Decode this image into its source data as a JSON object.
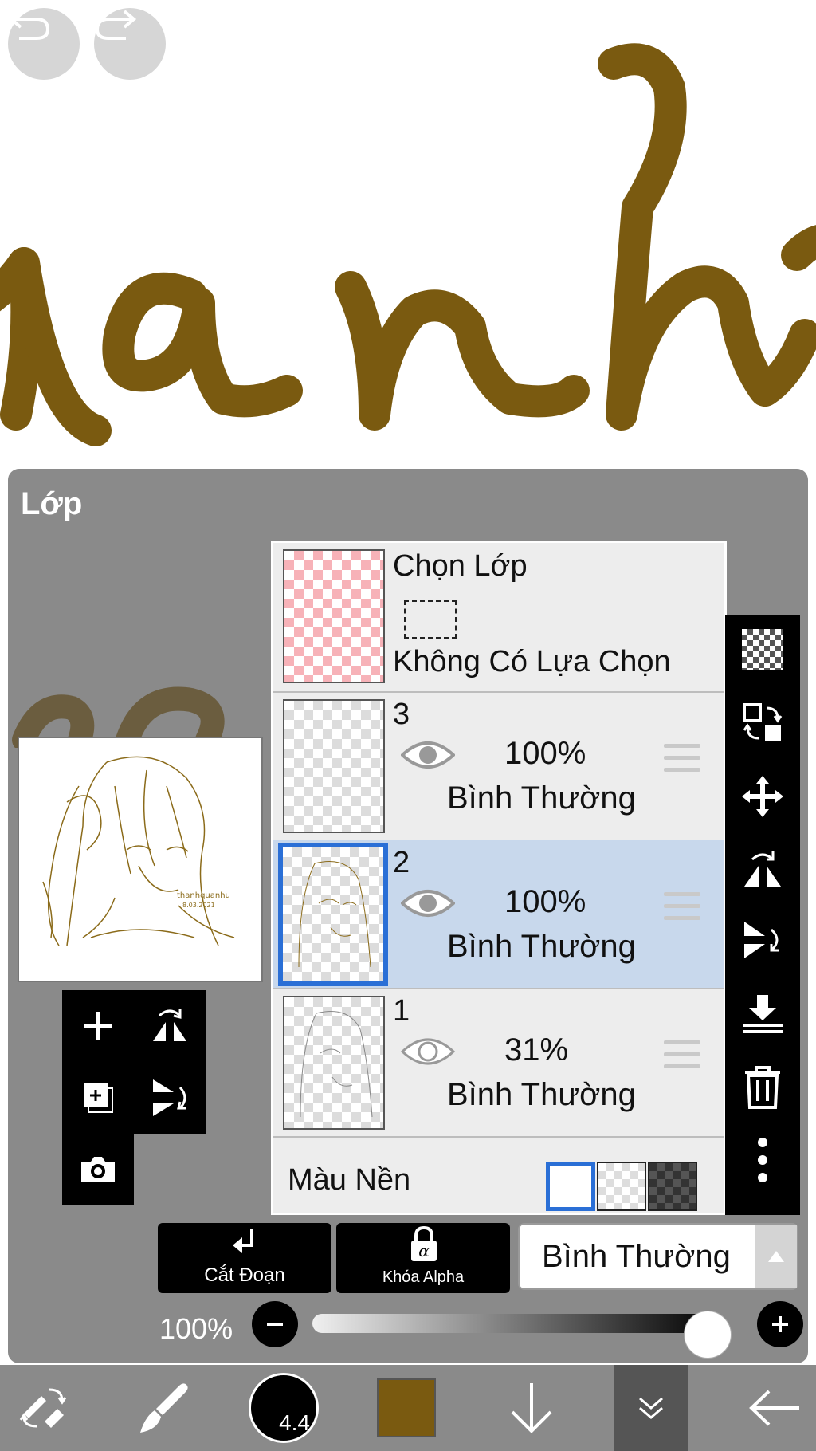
{
  "canvas": {
    "drawn_text": "anh",
    "ink_color": "#7a5a10"
  },
  "top_controls": {
    "undo_icon": "undo-icon",
    "redo_icon": "redo-icon"
  },
  "layer_panel": {
    "title": "Lớp",
    "selection_layer": {
      "title": "Chọn Lớp",
      "status": "Không Có Lựa Chọn"
    },
    "layers": [
      {
        "name": "3",
        "opacity": "100%",
        "blend": "Bình Thường",
        "visible": true
      },
      {
        "name": "2",
        "opacity": "100%",
        "blend": "Bình Thường",
        "visible": true,
        "selected": true
      },
      {
        "name": "1",
        "opacity": "31%",
        "blend": "Bình Thường",
        "visible": true
      }
    ],
    "background": {
      "label": "Màu Nền",
      "options": [
        "white",
        "transparent",
        "dark-checker"
      ],
      "selected": "white"
    },
    "clip_button": {
      "label": "Cắt Đoạn"
    },
    "alpha_lock_button": {
      "label": "Khóa Alpha"
    },
    "blend_select": {
      "value": "Bình Thường"
    },
    "opacity": {
      "label": "100%",
      "value": 1.0
    }
  },
  "bottom_bar": {
    "brush_size": "4.4",
    "current_color": "#7a5a10"
  },
  "colors": {
    "selected_row": "#c8d8ec",
    "accent": "#2a6fd6",
    "panel": "#8a8a8a"
  }
}
